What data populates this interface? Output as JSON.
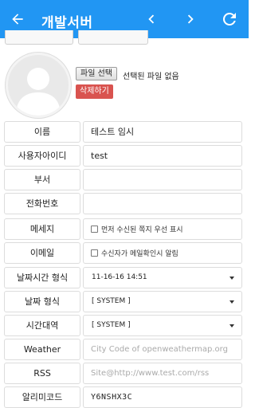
{
  "appbar": {
    "title": "개발서버",
    "icons": [
      "arrow-back-icon",
      "chevron-left-icon",
      "chevron-right-icon",
      "refresh-icon"
    ],
    "color": "#2196f3"
  },
  "profile": {
    "file_button": "파일 선택",
    "file_status": "선택된 파일 없음",
    "delete_button": "삭제하기",
    "delete_color": "#d9534f"
  },
  "fields": {
    "name": {
      "label": "이름",
      "value": "테스트 임시"
    },
    "user_id": {
      "label": "사용자아이디",
      "value": "test"
    },
    "department": {
      "label": "부서",
      "value": ""
    },
    "phone": {
      "label": "전화번호",
      "value": ""
    },
    "message": {
      "label": "메세지",
      "checkbox_label": "먼저 수신된 쪽지 우선 표시",
      "checked": false
    },
    "email": {
      "label": "이메일",
      "checkbox_label": "수신자가 메일확인시 알림",
      "checked": false
    },
    "datetime_format": {
      "label": "날짜시간 형식",
      "value": "11-16-16 14:51"
    },
    "date_format": {
      "label": "날짜 형식",
      "value": "[ SYSTEM ]"
    },
    "timezone": {
      "label": "시간대역",
      "value": "[ SYSTEM ]"
    },
    "weather": {
      "label": "Weather",
      "placeholder": "City Code of openweathermap.org"
    },
    "rss": {
      "label": "RSS",
      "placeholder": "Site@http://www.test.com/rss"
    },
    "alarm_code": {
      "label": "알리미코드",
      "value": "Y6NSHX3C"
    }
  }
}
